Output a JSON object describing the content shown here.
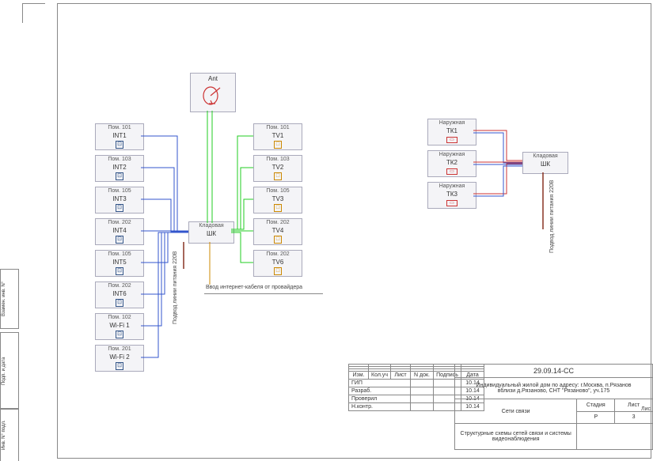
{
  "antenna": {
    "label": "Ant"
  },
  "int_nodes": [
    {
      "room": "Пом. 101",
      "dev": "INT1"
    },
    {
      "room": "Пом. 103",
      "dev": "INT2"
    },
    {
      "room": "Пом. 105",
      "dev": "INT3"
    },
    {
      "room": "Пом. 202",
      "dev": "INT4"
    },
    {
      "room": "Пом. 105",
      "dev": "INT5"
    },
    {
      "room": "Пом. 202",
      "dev": "INT6"
    },
    {
      "room": "Пом. 102",
      "dev": "Wi-Fi 1"
    },
    {
      "room": "Пом. 201",
      "dev": "Wi-Fi 2"
    }
  ],
  "tv_nodes": [
    {
      "room": "Пом. 101",
      "dev": "TV1"
    },
    {
      "room": "Пом. 103",
      "dev": "TV2"
    },
    {
      "room": "Пом. 105",
      "dev": "TV3"
    },
    {
      "room": "Пом. 202",
      "dev": "TV4"
    },
    {
      "room": "Пом. 202",
      "dev": "TV6"
    }
  ],
  "cabinet1": {
    "room": "Кладовая",
    "dev": "ШК"
  },
  "cam_nodes": [
    {
      "room": "Наружная",
      "dev": "ТК1"
    },
    {
      "room": "Наружная",
      "dev": "ТК2"
    },
    {
      "room": "Наружная",
      "dev": "ТК3"
    }
  ],
  "cabinet2": {
    "room": "Кладовая",
    "dev": "ШК"
  },
  "notes": {
    "power1": "Подвод линии питания 220В",
    "power2": "Подвод линии питания 220В",
    "inet": "Ввод интернет-кабеля от провайдера"
  },
  "titleblock": {
    "code": "29.09.14-СС",
    "project_l1": "Индивидуальный жилой дом по адресу: г.Москва, п.Рязанов",
    "project_l2": "вблизи д.Рязаново, СНТ \"Рязаново\", уч.175",
    "section": "Сети связи",
    "sheet_title": "Структурные схемы сетей связи и системы видеонаблюдения",
    "hdr_izm": "Изм.",
    "hdr_kol": "Кол.уч",
    "hdr_list": "Лист",
    "hdr_ndok": "N док.",
    "hdr_podp": "Подпись",
    "hdr_data": "Дата",
    "r_gip": "ГИП",
    "r_razrab": "Разраб.",
    "r_prov": "Проверил",
    "r_nkontr": "Н.контр.",
    "d1": "10.14",
    "d2": "10.14",
    "d3": "10.14",
    "d4": "10.14",
    "h_stad": "Стадия",
    "h_list": "Лист",
    "h_listov": "Лис",
    "v_stad": "Р",
    "v_list": "3"
  },
  "sidebar": {
    "s1": "Взамен. инв. N°",
    "s2": "Подп. и дата",
    "s3": "Инв. N° подл."
  }
}
